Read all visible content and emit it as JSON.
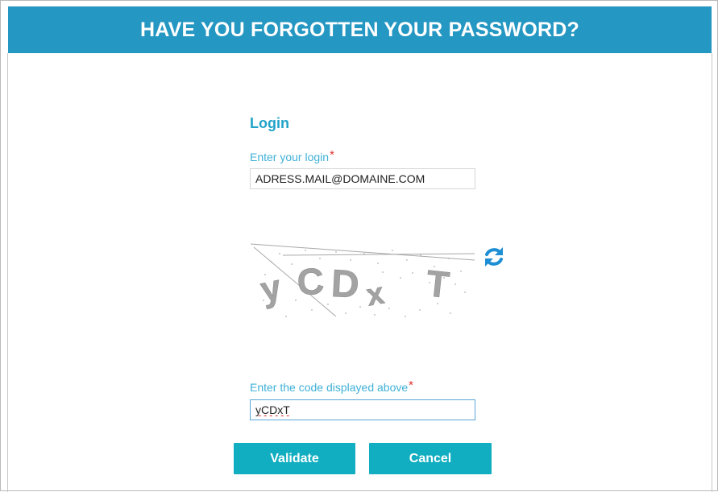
{
  "header": {
    "title": "HAVE YOU FORGOTTEN YOUR PASSWORD?"
  },
  "form": {
    "section_title": "Login",
    "login": {
      "label": "Enter your login",
      "required_marker": "*",
      "value": "ADRESS.MAIL@DOMAINE.COM"
    },
    "captcha": {
      "image_text": "yCDxT",
      "refresh_icon": "refresh-icon"
    },
    "code": {
      "label": "Enter the code displayed above",
      "required_marker": "*",
      "value": "yCDxT"
    }
  },
  "buttons": {
    "validate_label": "Validate",
    "cancel_label": "Cancel"
  },
  "colors": {
    "header_bg": "#2497c2",
    "accent_text": "#21a3c8",
    "label_text": "#3fb1d7",
    "required": "#e0322f",
    "button_bg": "#10aec0"
  }
}
